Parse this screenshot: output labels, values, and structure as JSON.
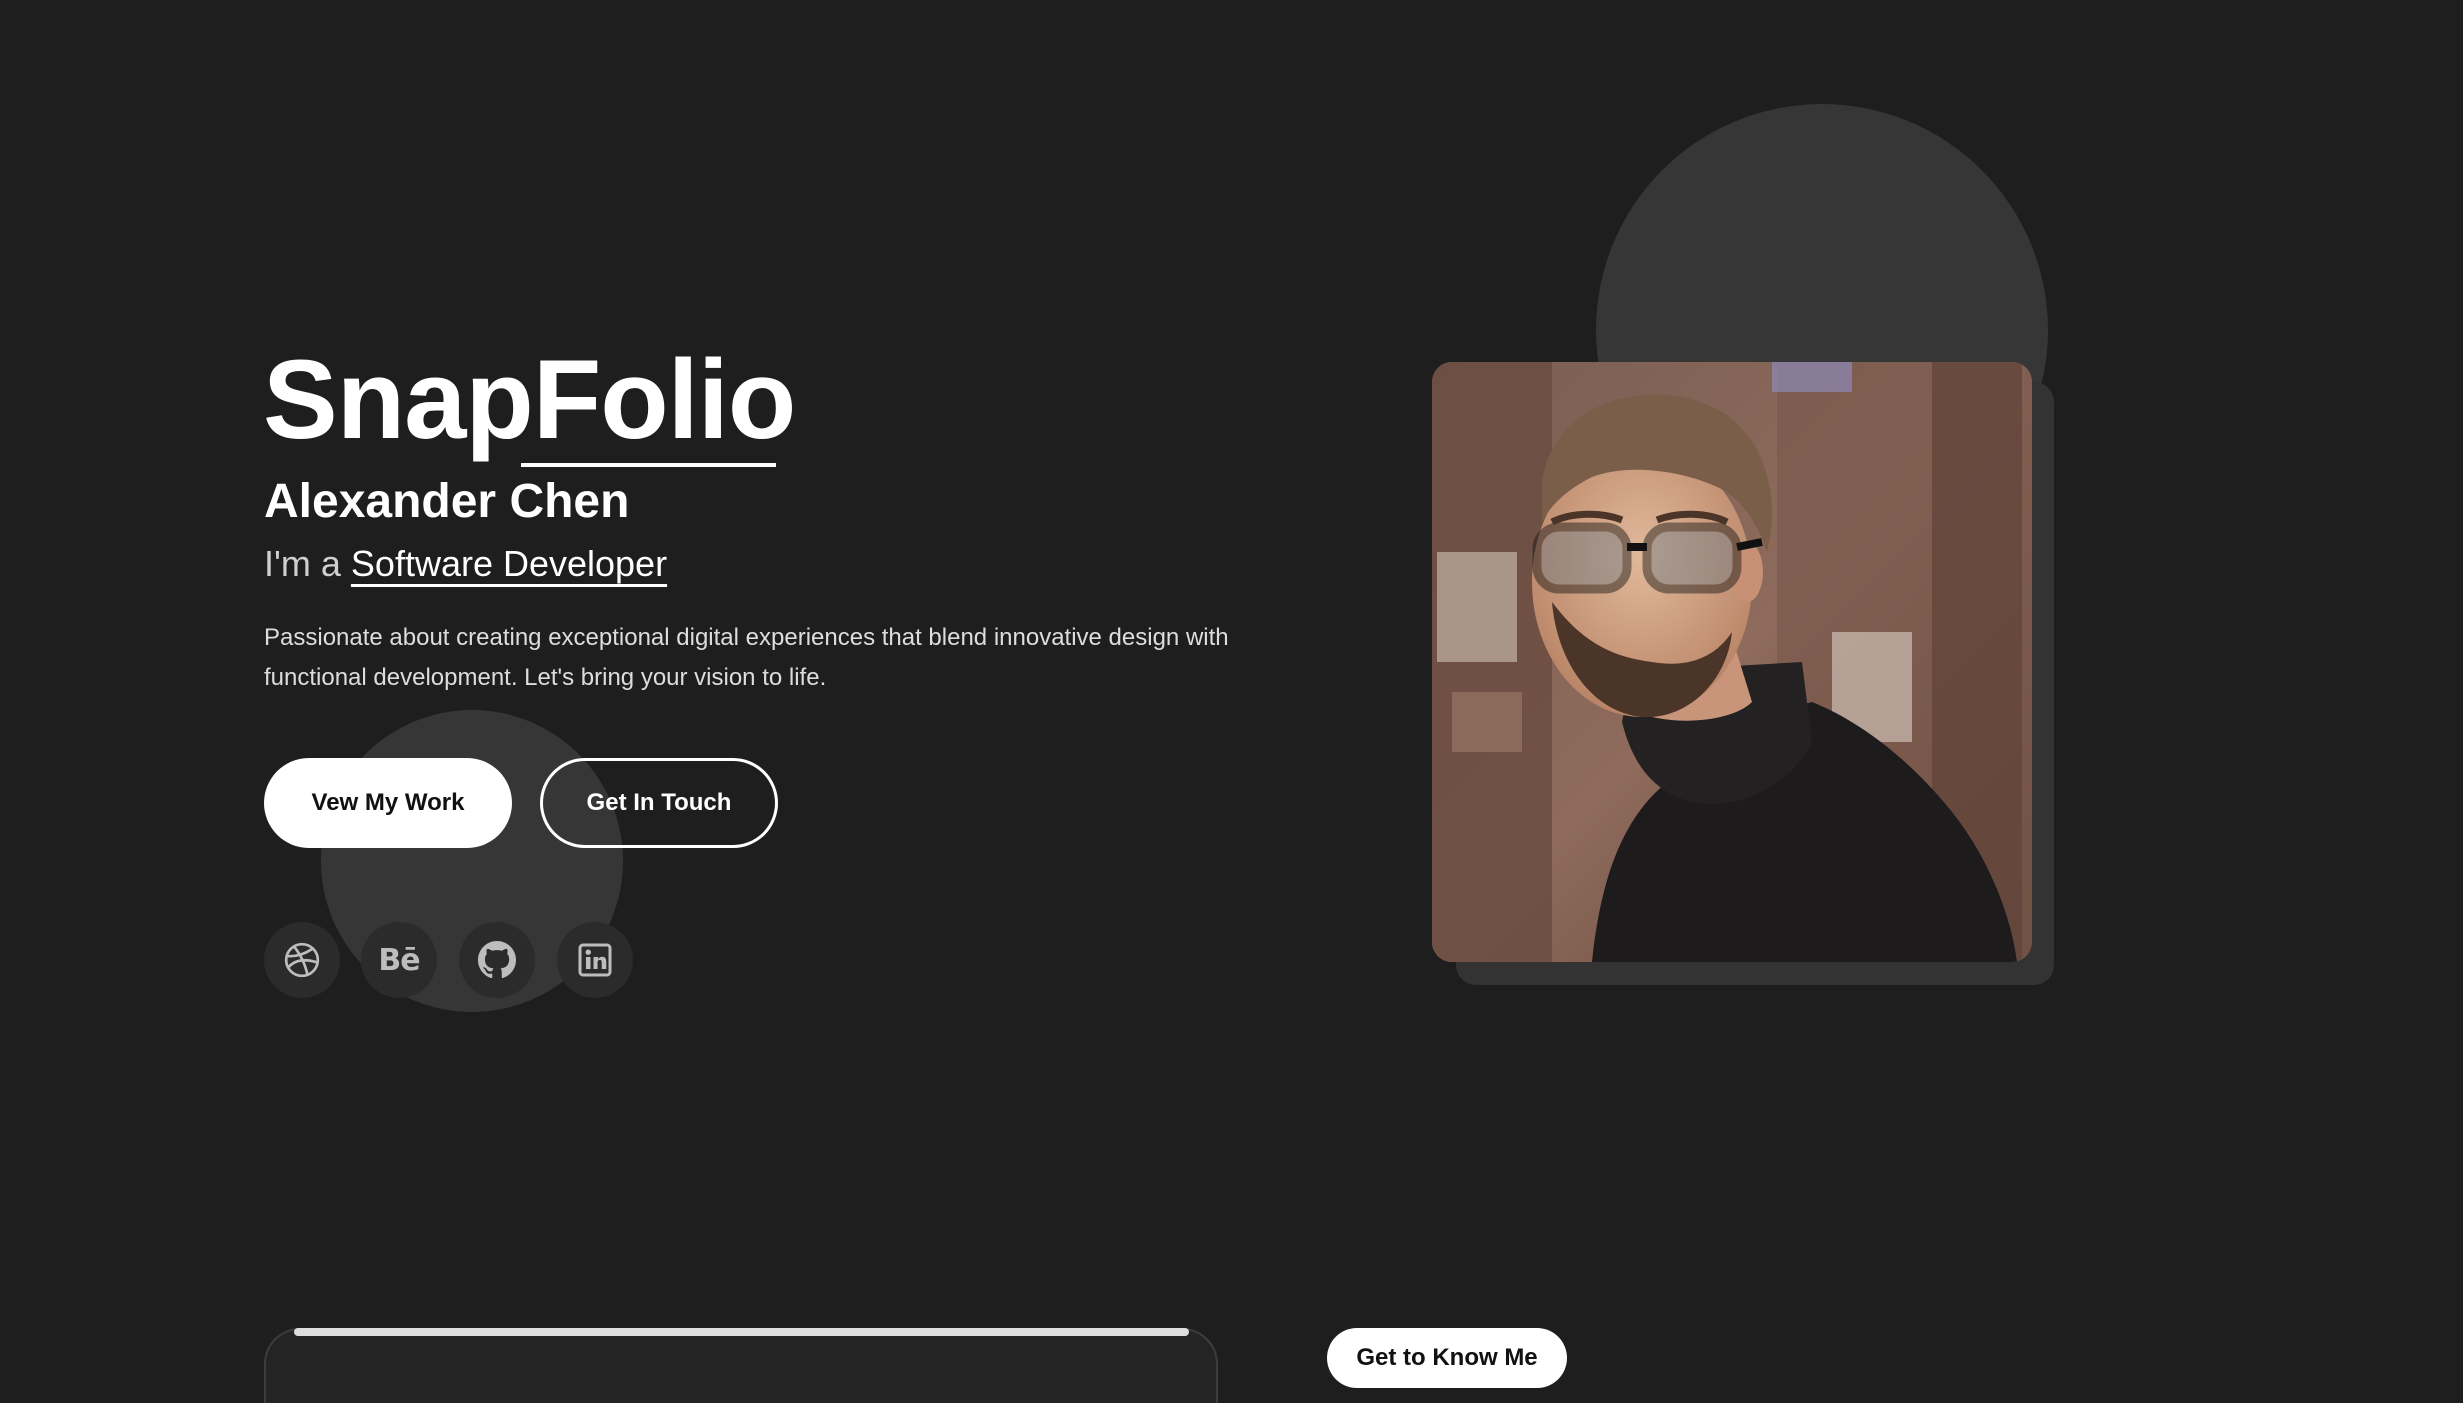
{
  "hero": {
    "brand": "SnapFolio",
    "name": "Alexander Chen",
    "role_prefix": "I'm a",
    "role": "Software Developer",
    "intro": "Passionate about creating exceptional digital experiences that blend innovative design with functional development. Let's bring your vision to life."
  },
  "buttons": {
    "primary_label": "Vew My Work",
    "secondary_label": "Get In Touch"
  },
  "social": {
    "behance_glyph": "Bē",
    "items": [
      {
        "icon": "dribbble-icon"
      },
      {
        "icon": "behance-icon"
      },
      {
        "icon": "github-icon"
      },
      {
        "icon": "linkedin-icon"
      }
    ]
  },
  "about": {
    "tag_label": "Get to Know Me"
  },
  "colors": {
    "background": "#1e1e1e",
    "accent": "#ffffff",
    "shape": "#363636",
    "icon": "#bdbdbd"
  }
}
